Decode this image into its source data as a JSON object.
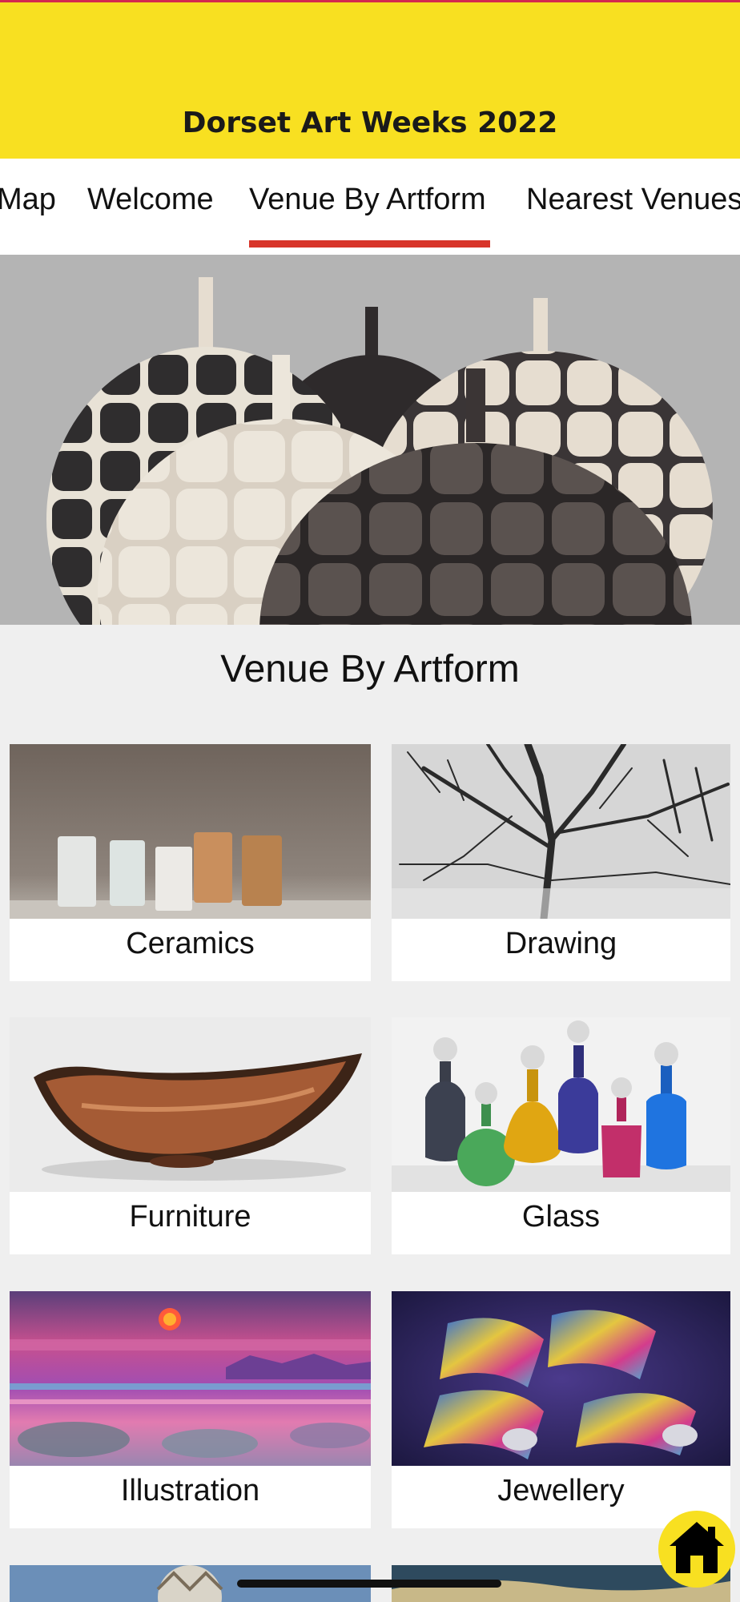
{
  "app": {
    "title": "Dorset Art Weeks 2022",
    "accent_color": "#f8e021",
    "indicator_color": "#d8352a"
  },
  "tabs": [
    {
      "label": "Map",
      "selected": false
    },
    {
      "label": "Welcome",
      "selected": false
    },
    {
      "label": "Venue By Artform",
      "selected": true
    },
    {
      "label": "Nearest Venues",
      "selected": false
    }
  ],
  "hero": {
    "icon": "pottery-vessels-photo"
  },
  "section": {
    "title": "Venue By Artform"
  },
  "artforms": [
    {
      "label": "Ceramics",
      "icon": "ceramics-photo"
    },
    {
      "label": "Drawing",
      "icon": "drawing-photo"
    },
    {
      "label": "Furniture",
      "icon": "furniture-photo"
    },
    {
      "label": "Glass",
      "icon": "glass-photo"
    },
    {
      "label": "Illustration",
      "icon": "illustration-photo"
    },
    {
      "label": "Jewellery",
      "icon": "jewellery-photo"
    }
  ],
  "fab": {
    "icon": "home-icon"
  }
}
